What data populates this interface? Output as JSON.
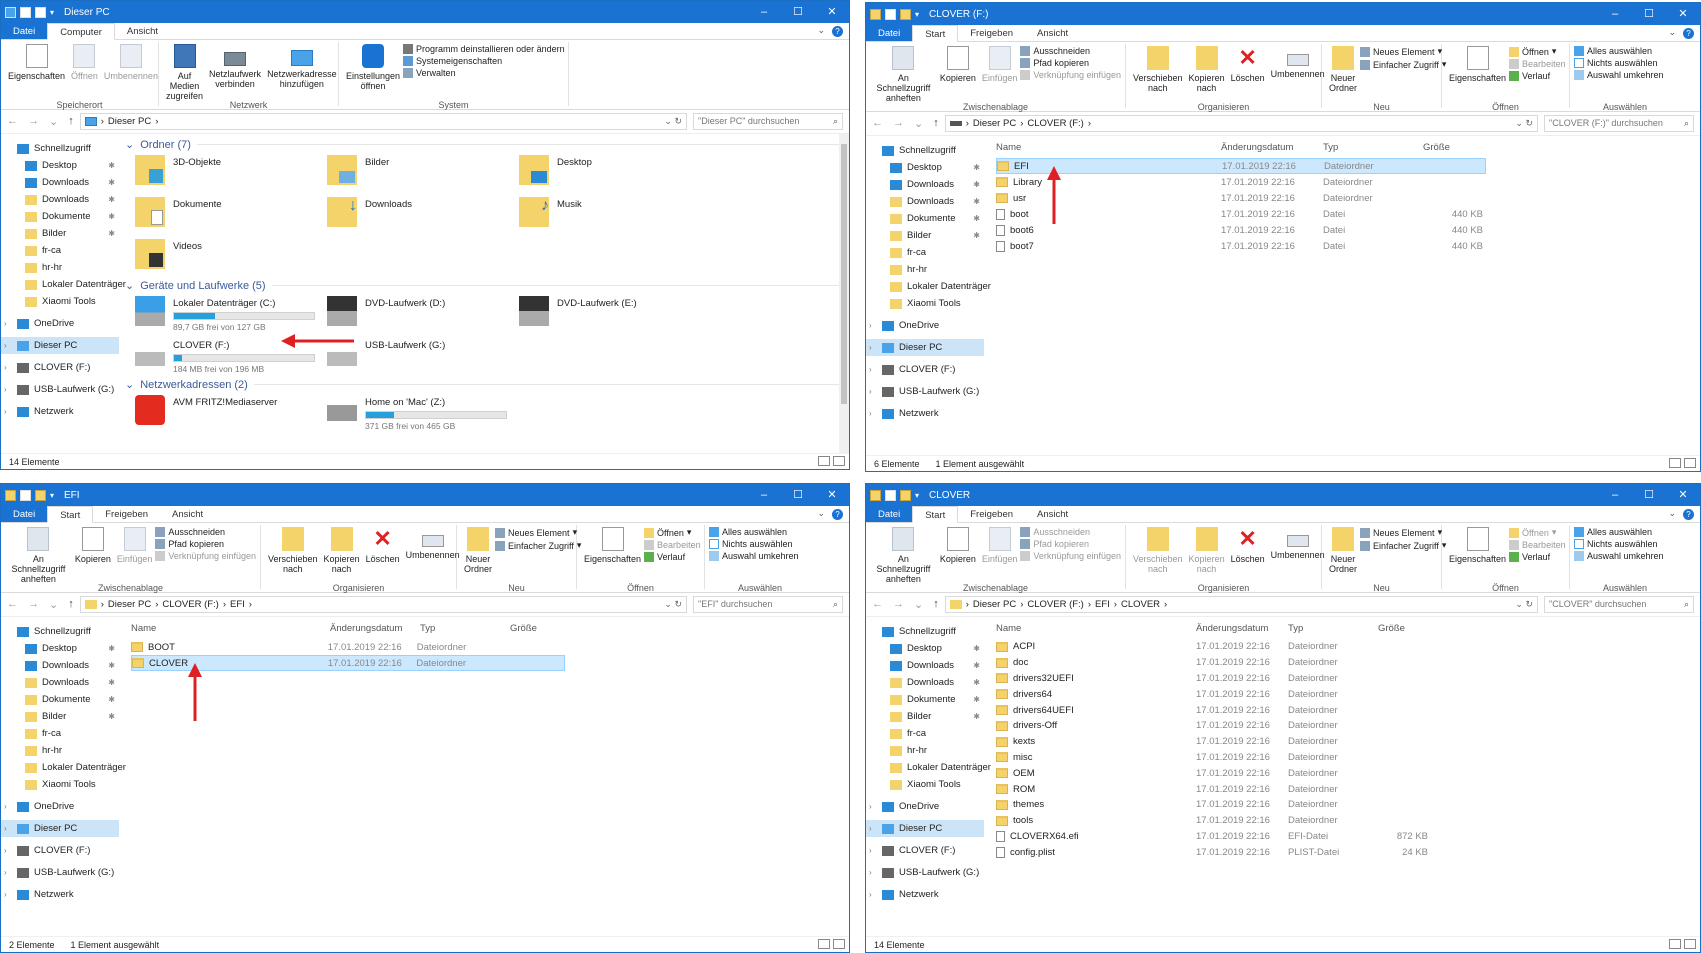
{
  "w1": {
    "title": "Dieser PC",
    "tabs": [
      "Datei",
      "Computer",
      "Ansicht"
    ],
    "ribbon": {
      "groups": [
        {
          "label": "Speicherort",
          "big": [
            "Eigenschaften",
            "Öffnen",
            "Umbenennen"
          ]
        },
        {
          "label": "Netzwerk",
          "big": [
            "Auf Medien zugreifen",
            "Netzlaufwerk verbinden",
            "Netzwerkadresse hinzufügen"
          ]
        },
        {
          "label": "System",
          "big": [
            "Einstellungen öffnen"
          ],
          "small": [
            "Programm deinstallieren oder ändern",
            "Systemeigenschaften",
            "Verwalten"
          ]
        }
      ]
    },
    "path": [
      "Dieser PC"
    ],
    "search": "\"Dieser PC\" durchsuchen",
    "sidebar": [
      "Schnellzugriff",
      "Desktop",
      "Downloads",
      "Downloads",
      "Dokumente",
      "Bilder",
      "fr-ca",
      "hr-hr",
      "Lokaler Datenträger",
      "Xiaomi Tools",
      "OneDrive",
      "Dieser PC",
      "CLOVER (F:)",
      "USB-Laufwerk (G:)",
      "Netzwerk"
    ],
    "groups": {
      "folders": "Ordner (7)",
      "devices": "Geräte und Laufwerke (5)",
      "network": "Netzwerkadressen (2)"
    },
    "folders": [
      "3D-Objekte",
      "Bilder",
      "Desktop",
      "Dokumente",
      "Downloads",
      "Musik",
      "Videos"
    ],
    "drives": [
      {
        "name": "Lokaler Datenträger (C:)",
        "free": "89,7 GB frei von 127 GB",
        "fill": 0.29
      },
      {
        "name": "DVD-Laufwerk (D:)"
      },
      {
        "name": "DVD-Laufwerk (E:)"
      },
      {
        "name": "CLOVER (F:)",
        "free": "184 MB frei von 196 MB",
        "fill": 0.06
      },
      {
        "name": "USB-Laufwerk (G:)"
      }
    ],
    "netloc": [
      {
        "name": "AVM FRITZ!Mediaserver"
      },
      {
        "name": "Home on 'Mac' (Z:)",
        "free": "371 GB frei von 465 GB",
        "fill": 0.2
      }
    ],
    "status": [
      "14 Elemente"
    ]
  },
  "common": {
    "tabs": [
      "Datei",
      "Start",
      "Freigeben",
      "Ansicht"
    ],
    "ribbon": {
      "clip": {
        "label": "Zwischenablage",
        "big": [
          "An Schnellzugriff anheften",
          "Kopieren",
          "Einfügen"
        ],
        "small": [
          "Ausschneiden",
          "Pfad kopieren",
          "Verknüpfung einfügen"
        ]
      },
      "org": {
        "label": "Organisieren",
        "big": [
          "Verschieben nach",
          "Kopieren nach",
          "Löschen",
          "Umbenennen"
        ]
      },
      "neu": {
        "label": "Neu",
        "big": [
          "Neuer Ordner"
        ],
        "small": [
          "Neues Element",
          "Einfacher Zugriff"
        ]
      },
      "open": {
        "label": "Öffnen",
        "big": [
          "Eigenschaften"
        ],
        "small": [
          "Öffnen",
          "Bearbeiten",
          "Verlauf"
        ]
      },
      "sel": {
        "label": "Auswählen",
        "small": [
          "Alles auswählen",
          "Nichts auswählen",
          "Auswahl umkehren"
        ]
      }
    },
    "cols": [
      "Name",
      "Änderungsdatum",
      "Typ",
      "Größe"
    ],
    "sidebar": [
      "Schnellzugriff",
      "Desktop",
      "Downloads",
      "Downloads",
      "Dokumente",
      "Bilder",
      "fr-ca",
      "hr-hr",
      "Lokaler Datenträger",
      "Xiaomi Tools",
      "OneDrive",
      "Dieser PC",
      "CLOVER (F:)",
      "USB-Laufwerk (G:)",
      "Netzwerk"
    ]
  },
  "w2": {
    "title": "CLOVER (F:)",
    "path": [
      "Dieser PC",
      "CLOVER (F:)"
    ],
    "search": "\"CLOVER (F:)\" durchsuchen",
    "rows": [
      [
        "EFI",
        "17.01.2019 22:16",
        "Dateiordner",
        ""
      ],
      [
        "Library",
        "17.01.2019 22:16",
        "Dateiordner",
        ""
      ],
      [
        "usr",
        "17.01.2019 22:16",
        "Dateiordner",
        ""
      ],
      [
        "boot",
        "17.01.2019 22:16",
        "Datei",
        "440 KB"
      ],
      [
        "boot6",
        "17.01.2019 22:16",
        "Datei",
        "440 KB"
      ],
      [
        "boot7",
        "17.01.2019 22:16",
        "Datei",
        "440 KB"
      ]
    ],
    "status": [
      "6 Elemente",
      "1 Element ausgewählt"
    ]
  },
  "w3": {
    "title": "EFI",
    "path": [
      "Dieser PC",
      "CLOVER (F:)",
      "EFI"
    ],
    "search": "\"EFI\" durchsuchen",
    "rows": [
      [
        "BOOT",
        "17.01.2019 22:16",
        "Dateiordner",
        ""
      ],
      [
        "CLOVER",
        "17.01.2019 22:16",
        "Dateiordner",
        ""
      ]
    ],
    "status": [
      "2 Elemente",
      "1 Element ausgewählt"
    ]
  },
  "w4": {
    "title": "CLOVER",
    "path": [
      "Dieser PC",
      "CLOVER (F:)",
      "EFI",
      "CLOVER"
    ],
    "search": "\"CLOVER\" durchsuchen",
    "rows": [
      [
        "ACPI",
        "17.01.2019 22:16",
        "Dateiordner",
        ""
      ],
      [
        "doc",
        "17.01.2019 22:16",
        "Dateiordner",
        ""
      ],
      [
        "drivers32UEFI",
        "17.01.2019 22:16",
        "Dateiordner",
        ""
      ],
      [
        "drivers64",
        "17.01.2019 22:16",
        "Dateiordner",
        ""
      ],
      [
        "drivers64UEFI",
        "17.01.2019 22:16",
        "Dateiordner",
        ""
      ],
      [
        "drivers-Off",
        "17.01.2019 22:16",
        "Dateiordner",
        ""
      ],
      [
        "kexts",
        "17.01.2019 22:16",
        "Dateiordner",
        ""
      ],
      [
        "misc",
        "17.01.2019 22:16",
        "Dateiordner",
        ""
      ],
      [
        "OEM",
        "17.01.2019 22:16",
        "Dateiordner",
        ""
      ],
      [
        "ROM",
        "17.01.2019 22:16",
        "Dateiordner",
        ""
      ],
      [
        "themes",
        "17.01.2019 22:16",
        "Dateiordner",
        ""
      ],
      [
        "tools",
        "17.01.2019 22:16",
        "Dateiordner",
        ""
      ],
      [
        "CLOVERX64.efi",
        "17.01.2019 22:16",
        "EFI-Datei",
        "872 KB"
      ],
      [
        "config.plist",
        "17.01.2019 22:16",
        "PLIST-Datei",
        "24 KB"
      ]
    ],
    "status": [
      "14 Elemente"
    ]
  }
}
